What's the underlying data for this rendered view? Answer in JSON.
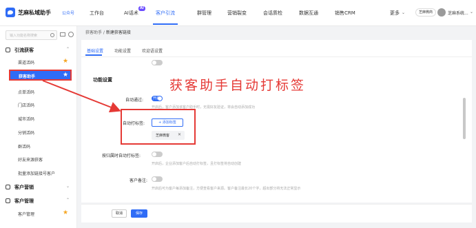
{
  "header": {
    "app_title": "芝麻私域助手",
    "app_sub": "公众号 ",
    "nav": [
      "工作台",
      "AI话术",
      "客户引流",
      "群管理",
      "营销裂变",
      "会话质检",
      "数据互通",
      "销售CRM",
      "更多"
    ],
    "ai_badge": "AI",
    "active_nav": "客户引流",
    "more_chevron": "⌄",
    "brand_badge": "芝麻微商",
    "user_name": "芝麻系统...",
    "user_chevron": "⌄",
    "colors": {
      "accent": "#2f6cf6",
      "annotation_red": "#e53935"
    }
  },
  "sidebar": {
    "search_placeholder": "输入功能名称搜索",
    "groups": [
      {
        "label": "引流获客",
        "chevron": "⌃"
      },
      {
        "label": "客户营销",
        "chevron": "⌄"
      },
      {
        "label": "客户管理",
        "chevron": "⌃"
      }
    ],
    "items": [
      "渠道活码",
      "获客助手",
      "点单活码",
      "门店活码",
      "城市活码",
      "分销活码",
      "群活码",
      "好友来源获客",
      "批量添加链接号客户"
    ],
    "active_item": "获客助手",
    "customer_item": "客户管理",
    "star_icon": "★"
  },
  "breadcrumb": {
    "root": "获客助手",
    "separator": " / ",
    "current": "新建获客链接"
  },
  "tabs": [
    "基础设置",
    "功能设置",
    "欢迎语设置"
  ],
  "form": {
    "section_title": "功能设置",
    "auto_pass_label": "自动通过:",
    "toggle_on": "开启",
    "auto_pass_help": "开启后，客户添加该客户助手时，无需好友验证，将会自动添加成功",
    "auto_tag_label": "自动打标签:",
    "add_tag": "+ 添加标签",
    "tag_value": "芝麻微客",
    "tag_close": "✕",
    "auto_tag_interaction_label": "按归属时自动打标签:",
    "auto_tag_interaction_help": "开启后，企业添加客户后自动打标签，且打标签将自动创建",
    "customer_remark_label": "客户备注:",
    "customer_remark_help": "开启后可为客户每添加备注，方便查看客户来源。客户备注最长20个字，超出部分将无法正常显示"
  },
  "annotation": {
    "text": "获客助手自动打标签"
  },
  "footer": {
    "cancel": "取消",
    "save": "保存"
  }
}
